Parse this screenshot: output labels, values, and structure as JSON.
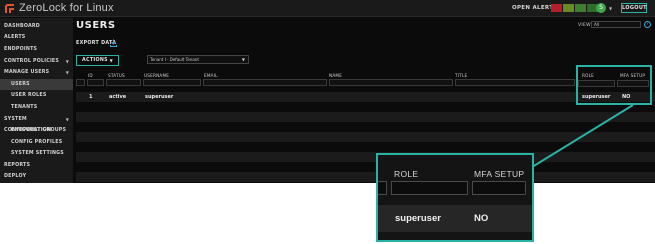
{
  "app": {
    "title": "ZeroLock for Linux",
    "open_alerts_label": "OPEN ALERTS",
    "alert_colors": [
      "#b3202a",
      "#6a8a26",
      "#3d7f2e",
      "#2e6e2a"
    ],
    "user_initial": "S",
    "logout_label": "LOGOUT",
    "accent": "#2ab3a5"
  },
  "sidebar": {
    "items": [
      {
        "label": "DASHBOARD"
      },
      {
        "label": "ALERTS"
      },
      {
        "label": "ENDPOINTS"
      },
      {
        "label": "CONTROL POLICIES"
      },
      {
        "label": "MANAGE USERS"
      },
      {
        "label": "USERS"
      },
      {
        "label": "USER ROLES"
      },
      {
        "label": "TENANTS"
      },
      {
        "label": "SYSTEM CONFIGURATION"
      },
      {
        "label": "ENDPOINT GROUPS"
      },
      {
        "label": "CONFIG PROFILES"
      },
      {
        "label": "SYSTEM SETTINGS"
      },
      {
        "label": "REPORTS"
      },
      {
        "label": "DEPLOY"
      }
    ]
  },
  "page": {
    "title": "USERS",
    "view_label": "VIEW",
    "view_value": "All",
    "export_label": "EXPORT DATA",
    "actions_label": "ACTIONS",
    "tenant_value": "Tenant I - Default Tenant"
  },
  "table": {
    "headers": {
      "id": "ID",
      "status": "STATUS",
      "username": "USERNAME",
      "email": "EMAIL",
      "name": "NAME",
      "title": "TITLE",
      "role": "ROLE",
      "mfa": "MFA SETUP"
    },
    "rows": [
      {
        "id": "1",
        "status": "active",
        "username": "superuser",
        "email": "",
        "name": "",
        "title": "",
        "role": "superuser",
        "mfa": "NO"
      }
    ]
  },
  "zoom": {
    "role_header": "ROLE",
    "mfa_header": "MFA SETUP",
    "role_value": "superuser",
    "mfa_value": "NO"
  }
}
